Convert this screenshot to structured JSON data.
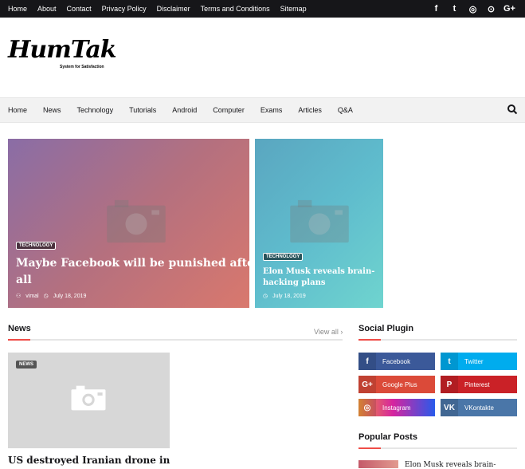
{
  "topbar": {
    "links": [
      "Home",
      "About",
      "Contact",
      "Privacy Policy",
      "Disclaimer",
      "Terms and Conditions",
      "Sitemap"
    ],
    "social_icons": [
      "facebook-icon",
      "twitter-icon",
      "instagram-icon",
      "github-icon",
      "google-plus-icon"
    ],
    "social_glyphs": [
      "f",
      "t",
      "◎",
      "⊙",
      "G+"
    ]
  },
  "logo": {
    "title": "HumTak",
    "tagline": "System for Satisfaction"
  },
  "nav": {
    "items": [
      "Home",
      "News",
      "Technology",
      "Tutorials",
      "Android",
      "Computer",
      "Exams",
      "Articles",
      "Q&A"
    ]
  },
  "featured": [
    {
      "badge": "TECHNOLOGY",
      "title_line1": "Maybe Facebook will be punished after",
      "title_line2": "all",
      "author": "vimal",
      "date": "July 18, 2019"
    },
    {
      "badge": "TECHNOLOGY",
      "title_line1": "Elon Musk reveals brain-",
      "title_line2": "hacking plans",
      "date": "July 18, 2019"
    }
  ],
  "news": {
    "heading": "News",
    "view_all": "View all ›",
    "badge": "NEWS",
    "title": "US destroyed Iranian drone in"
  },
  "social_plugin": {
    "heading": "Social Plugin",
    "buttons": [
      {
        "label": "Facebook",
        "glyph": "f",
        "color": "#3b5999"
      },
      {
        "label": "Twitter",
        "glyph": "t",
        "color": "#00acee"
      },
      {
        "label": "Google Plus",
        "glyph": "G+",
        "color": "#db4a39"
      },
      {
        "label": "Pinterest",
        "glyph": "P",
        "color": "#ca2127"
      },
      {
        "label": "Instagram",
        "glyph": "◎",
        "color": "#d6249f"
      },
      {
        "label": "VKontakte",
        "glyph": "VK",
        "color": "#4a76a8"
      }
    ]
  },
  "popular": {
    "heading": "Popular Posts",
    "first_title": "Elon Musk reveals brain-"
  },
  "colors": {
    "accent": "#ef4d48",
    "dark": "#161619"
  }
}
